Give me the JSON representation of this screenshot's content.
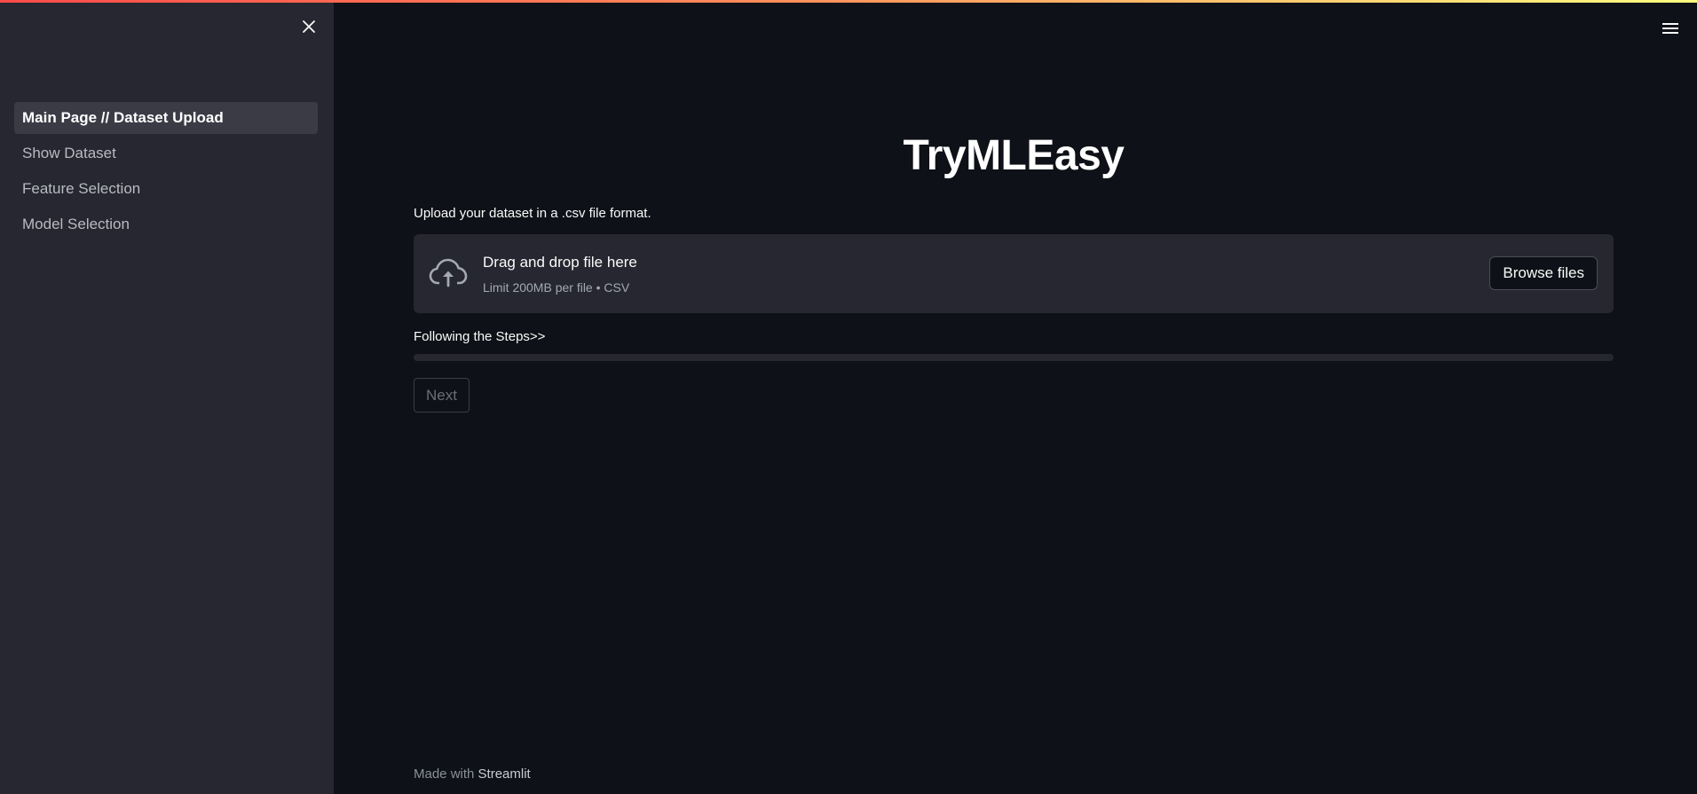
{
  "sidebar": {
    "items": [
      {
        "label": "Main Page // Dataset Upload",
        "active": true
      },
      {
        "label": "Show Dataset",
        "active": false
      },
      {
        "label": "Feature Selection",
        "active": false
      },
      {
        "label": "Model Selection",
        "active": false
      }
    ],
    "close_icon": "close-icon"
  },
  "header": {
    "menu_icon": "hamburger-icon"
  },
  "main": {
    "title": "TryMLEasy",
    "upload_label": "Upload your dataset in a .csv file format.",
    "dropzone": {
      "icon": "cloud-upload-icon",
      "title": "Drag and drop file here",
      "subtitle": "Limit 200MB per file • CSV",
      "browse_label": "Browse files"
    },
    "steps_label": "Following the Steps>>",
    "progress": 0,
    "next_label": "Next"
  },
  "footer": {
    "prefix": "Made with ",
    "link": "Streamlit"
  },
  "colors": {
    "background": "#0e1117",
    "sidebar": "#262730",
    "accent": "#ff4b4b"
  }
}
